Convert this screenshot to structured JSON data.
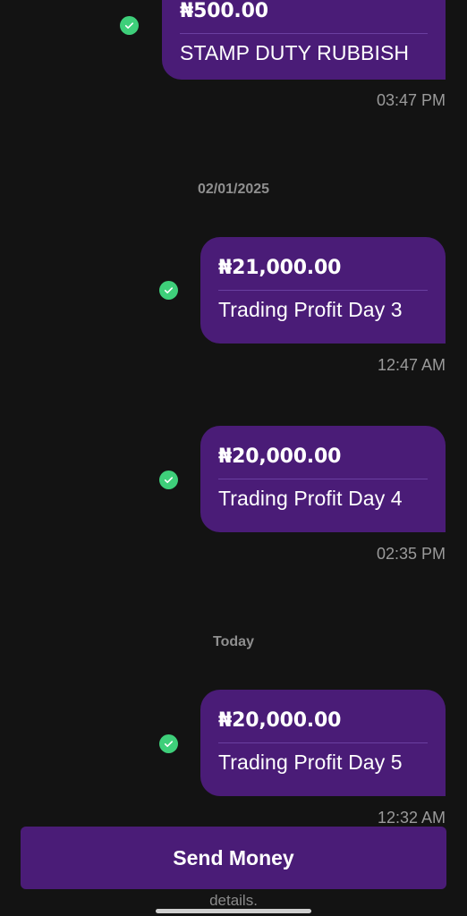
{
  "messages": [
    {
      "amount": "₦500.00",
      "note": "STAMP DUTY RUBBISH",
      "time": "03:47 PM",
      "icon": "check-circle-icon"
    },
    {
      "amount": "₦21,000.00",
      "note": "Trading Profit Day 3",
      "time": "12:47 AM",
      "icon": "check-circle-icon"
    },
    {
      "amount": "₦20,000.00",
      "note": "Trading Profit Day 4",
      "time": "02:35 PM",
      "icon": "check-circle-icon"
    },
    {
      "amount": "₦20,000.00",
      "note": "Trading Profit Day 5",
      "time": "12:32 AM",
      "icon": "check-circle-icon"
    }
  ],
  "separators": {
    "first": "02/01/2025",
    "second": "Today"
  },
  "send_button": {
    "label": "Send Money"
  },
  "footer": {
    "text": "details."
  },
  "colors": {
    "background": "#131313",
    "bubble": "#4a1c77",
    "check": "#3ecf7a",
    "muted_text": "#9a9a9a"
  }
}
